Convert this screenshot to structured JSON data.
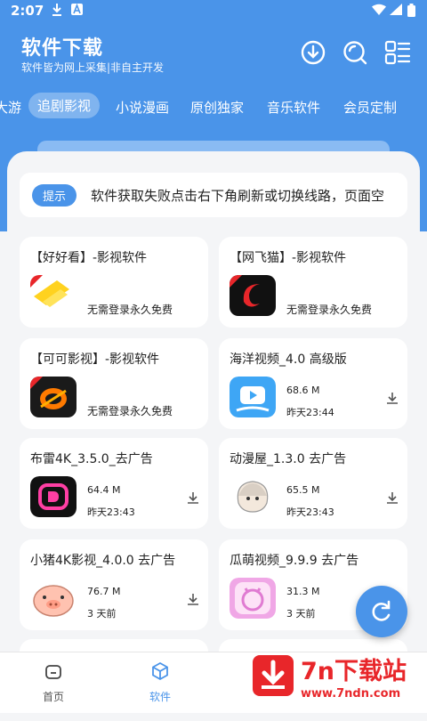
{
  "status": {
    "time": "2:07"
  },
  "header": {
    "title": "软件下载",
    "subtitle": "软件皆为网上采集|非自主开发"
  },
  "tabs": [
    {
      "label": "大游"
    },
    {
      "label": "追剧影视",
      "active": true
    },
    {
      "label": "小说漫画"
    },
    {
      "label": "原创独家"
    },
    {
      "label": "音乐软件"
    },
    {
      "label": "会员定制"
    }
  ],
  "notice": {
    "badge": "提示",
    "text": "软件获取失败点击右下角刷新或切换线路，页面空"
  },
  "cards": [
    {
      "title": "【好好看】-影视软件",
      "note": "无需登录永久免费",
      "icon": "haohaokan-icon"
    },
    {
      "title": "【网飞猫】-影视软件",
      "note": "无需登录永久免费",
      "icon": "wangfeimao-icon"
    },
    {
      "title": "【可可影视】-影视软件",
      "note": "无需登录永久免费",
      "icon": "keke-icon"
    },
    {
      "title": "海洋视频_4.0 高级版",
      "size": "68.6 M",
      "date": "昨天23:44",
      "icon": "haiyang-icon"
    },
    {
      "title": "布雷4K_3.5.0_去广告",
      "size": "64.4 M",
      "date": "昨天23:43",
      "icon": "bulei-icon"
    },
    {
      "title": "动漫屋_1.3.0 去广告",
      "size": "65.5 M",
      "date": "昨天23:43",
      "icon": "dongmanwu-icon"
    },
    {
      "title": "小猪4K影视_4.0.0 去广告",
      "size": "76.7 M",
      "date": "3 天前",
      "icon": "pig-icon"
    },
    {
      "title": "瓜萌视频_9.9.9 去广告",
      "size": "31.3 M",
      "date": "3 天前",
      "icon": "guameng-icon"
    }
  ],
  "bottom_nav": [
    {
      "label": "首页",
      "icon": "home-icon"
    },
    {
      "label": "软件",
      "icon": "cube-icon",
      "active": true
    }
  ],
  "watermark": {
    "big": "7n下载站",
    "small": "www.7ndn.com"
  },
  "colors": {
    "primary": "#4a94e9",
    "watermark": "#e8262a"
  }
}
